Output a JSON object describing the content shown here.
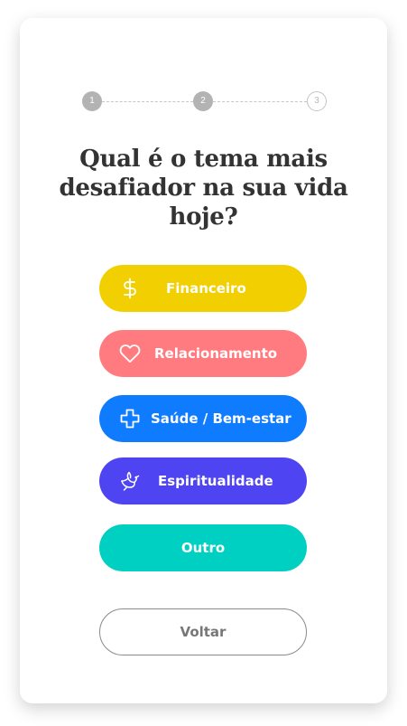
{
  "stepper": {
    "steps": [
      {
        "label": "1",
        "state": "done"
      },
      {
        "label": "2",
        "state": "current"
      },
      {
        "label": "3",
        "state": "todo"
      }
    ],
    "current_step": 2,
    "total_steps": 3
  },
  "question": "Qual é o tema mais desafiador na sua vida hoje?",
  "options": [
    {
      "label": "Financeiro",
      "icon": "dollar-sign-icon",
      "color": "#f2cf00"
    },
    {
      "label": "Relacionamento",
      "icon": "heart-icon",
      "color": "#ff7b80"
    },
    {
      "label": "Saúde / Bem-estar",
      "icon": "health-cross-icon",
      "color": "#0f7bff"
    },
    {
      "label": "Espiritualidade",
      "icon": "dove-icon",
      "color": "#4f44f2"
    },
    {
      "label": "Outro",
      "icon": "",
      "color": "#00d0c2"
    }
  ],
  "back_label": "Voltar"
}
